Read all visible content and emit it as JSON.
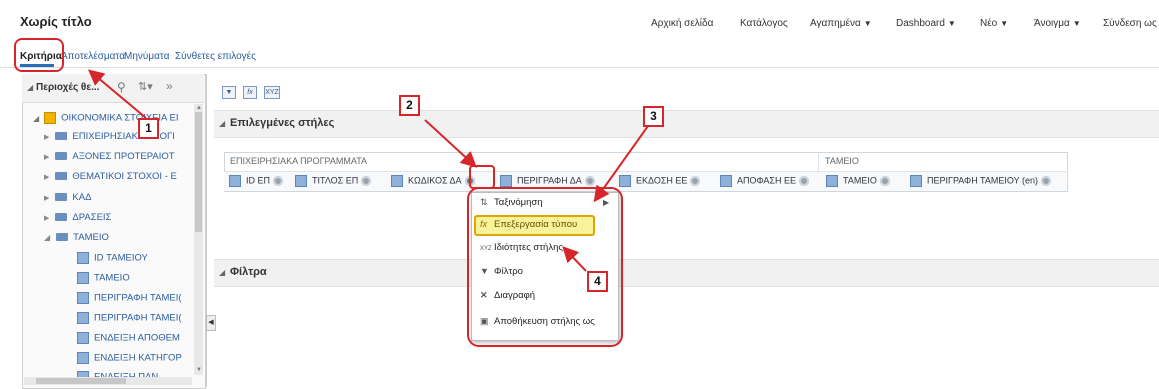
{
  "app": {
    "title": "Χωρίς τίτλο"
  },
  "top_nav": [
    {
      "label": "Αρχική σελίδα",
      "has_caret": false
    },
    {
      "label": "Κατάλογος",
      "has_caret": false
    },
    {
      "label": "Αγαπημένα",
      "has_caret": true
    },
    {
      "label": "Dashboard",
      "has_caret": true
    },
    {
      "label": "Νέο",
      "has_caret": true
    },
    {
      "label": "Άνοιγμα",
      "has_caret": true
    },
    {
      "label": "Σύνδεση ως",
      "has_caret": false
    }
  ],
  "tabs": [
    {
      "label": "Κριτήρια",
      "active": true
    },
    {
      "label": "Αποτελέσματα",
      "active": false
    },
    {
      "label": "Μηνύματα",
      "active": false
    },
    {
      "label": "Σύνθετες επιλογές",
      "active": false
    }
  ],
  "left_panel": {
    "header": "Περιοχές θε...",
    "header_controls": [
      "search-icon",
      "sort-icon",
      "expand-icon"
    ],
    "tree": [
      {
        "label": "ΟΙΚΟΝΟΜΙΚΑ ΣΤΟΙΧΕΙΑ ΕΙ",
        "level": 0,
        "type": "subject-area"
      },
      {
        "label": "ΕΠΙΧΕΙΡΗΣΙΑΚΑ ΠΡΟΓΙ",
        "level": 1,
        "type": "folder"
      },
      {
        "label": "ΑΞΟΝΕΣ ΠΡΟΤΕΡΑΙΟΤ",
        "level": 1,
        "type": "folder"
      },
      {
        "label": "ΘΕΜΑΤΙΚΟΙ ΣΤΟΧΟΙ - Ε",
        "level": 1,
        "type": "folder"
      },
      {
        "label": "ΚΑΔ",
        "level": 1,
        "type": "folder"
      },
      {
        "label": "ΔΡΑΣΕΙΣ",
        "level": 1,
        "type": "folder"
      },
      {
        "label": "ΤΑΜΕΙΟ",
        "level": 1,
        "type": "folder-open"
      },
      {
        "label": "ID ΤΑΜΕΙΟΥ",
        "level": 2,
        "type": "column"
      },
      {
        "label": "ΤΑΜΕΙΟ",
        "level": 2,
        "type": "column"
      },
      {
        "label": "ΠΕΡΙΓΡΑΦΗ ΤΑΜΕΙ(",
        "level": 2,
        "type": "column"
      },
      {
        "label": "ΠΕΡΙΓΡΑΦΗ ΤΑΜΕΙ(",
        "level": 2,
        "type": "column"
      },
      {
        "label": "ΕΝΔΕΙΞΗ ΑΠΟΘΕΜ",
        "level": 2,
        "type": "column"
      },
      {
        "label": "ΕΝΔΕΙΞΗ ΚΑΤΗΓΟΡ",
        "level": 2,
        "type": "column"
      },
      {
        "label": "ΕΝΔΕΙΞΗ ΠΑΝ",
        "level": 2,
        "type": "column"
      }
    ]
  },
  "toolbar": {
    "icons": [
      "filter-icon",
      "edit-formula-icon",
      "xyz-icon"
    ],
    "xyz_label": "XYZ"
  },
  "selected_columns": {
    "title": "Επιλεγμένες στήλες",
    "groups": [
      {
        "label": "ΕΠΙΧΕΙΡΗΣΙΑΚΑ ΠΡΟΓΡΑΜΜΑΤΑ"
      },
      {
        "label": "ΤΑΜΕΙΟ"
      }
    ],
    "columns": [
      {
        "label": "ID ΕΠ"
      },
      {
        "label": "ΤΙΤΛΟΣ ΕΠ"
      },
      {
        "label": "ΚΩΔΙΚΟΣ ΔΑ"
      },
      {
        "label": "ΠΕΡΙΓΡΑΦΗ ΔΑ"
      },
      {
        "label": "ΕΚΔΟΣΗ ΕΕ"
      },
      {
        "label": "ΑΠΟΦΑΣΗ ΕΕ"
      },
      {
        "label": "ΤΑΜΕΙΟ"
      },
      {
        "label": "ΠΕΡΙΓΡΑΦΗ ΤΑΜΕΙΟΥ (en)"
      }
    ]
  },
  "filters": {
    "title": "Φίλτρα"
  },
  "context_menu": {
    "items": [
      {
        "label": "Ταξινόμηση",
        "icon": "sort-icon",
        "has_submenu": true
      },
      {
        "label": "Επεξεργασία τύπου",
        "icon": "formula-icon",
        "highlighted": true
      },
      {
        "label": "Ιδιότητες στήλης",
        "icon": "column-properties-icon"
      },
      {
        "label": "Φίλτρο",
        "icon": "filter-icon"
      },
      {
        "label": "Διαγραφή",
        "icon": "delete-icon"
      },
      {
        "label": "Αποθήκευση στήλης ως",
        "icon": "save-icon"
      }
    ],
    "formula_glyph": "fx",
    "xyz_glyph": "XYZ"
  },
  "callouts": [
    "1",
    "2",
    "3",
    "4"
  ],
  "colors": {
    "accent": "#2a6eb6",
    "callout_red": "#d6262b",
    "highlight_yellow": "#f7f39a"
  }
}
